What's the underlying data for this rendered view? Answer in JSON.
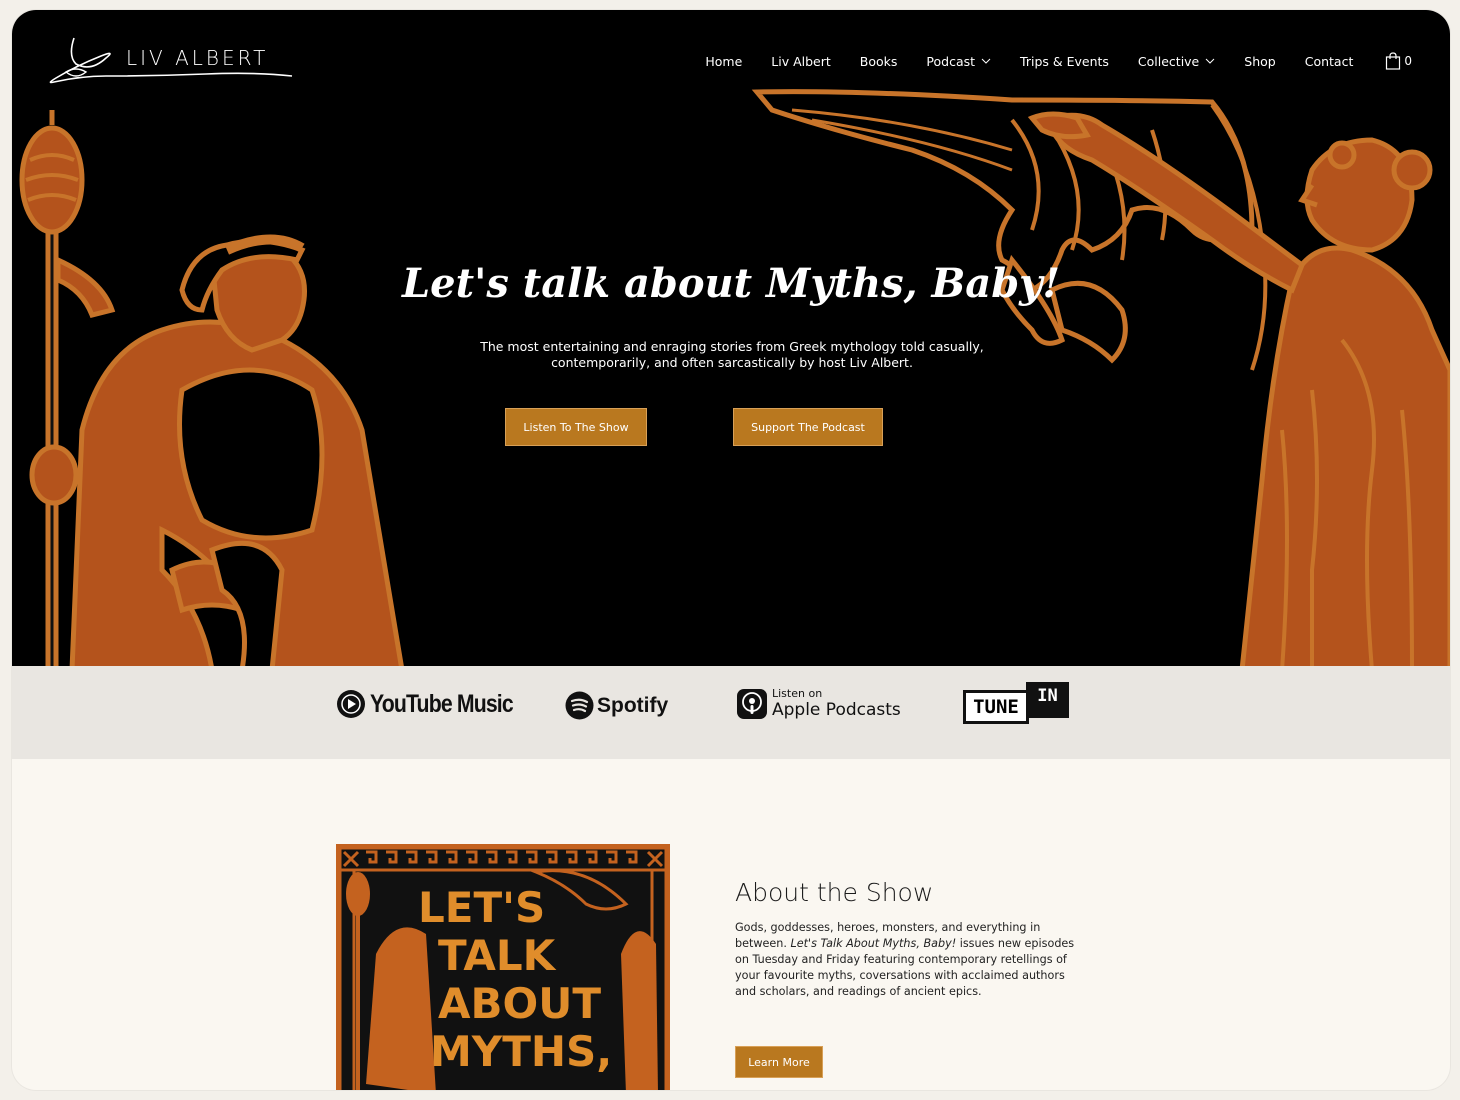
{
  "brand": {
    "name": "LIV ALBERT"
  },
  "nav": {
    "items": [
      {
        "label": "Home"
      },
      {
        "label": "Liv Albert"
      },
      {
        "label": "Books"
      },
      {
        "label": "Podcast"
      },
      {
        "label": "Trips & Events"
      },
      {
        "label": "Collective"
      },
      {
        "label": "Shop"
      },
      {
        "label": "Contact"
      }
    ],
    "cart_count": "0"
  },
  "hero": {
    "title": "Let's talk about Myths, Baby!",
    "subtitle": "The most entertaining and enraging stories from Greek mythology told casually, contemporarily, and often sarcastically by host Liv Albert.",
    "btn_listen": "Listen To The Show",
    "btn_support": "Support The Podcast"
  },
  "platforms": {
    "youtube": "YouTube Music",
    "spotify": "Spotify",
    "apple_small": "Listen on",
    "apple_big": "Apple Podcasts",
    "tune": "TUNE",
    "in": "IN"
  },
  "about": {
    "title": "About the Show",
    "body_pre": "Gods, goddesses, heroes, monsters, and everything in between. ",
    "body_italic": "Let's Talk About Myths, Baby!",
    "body_post": " issues new episodes on Tuesday and Friday featuring contemporary retellings of your favourite myths, coversations with acclaimed authors and scholars, and readings of ancient epics.",
    "learn_more": "Learn More",
    "cover_text": [
      "LET'S",
      "TALK",
      "ABOUT",
      "MYTHS,"
    ]
  },
  "colors": {
    "accent": "#b9781f",
    "art_orange": "#b4531c",
    "art_line": "#c8742a",
    "hero_bg": "#000000"
  }
}
